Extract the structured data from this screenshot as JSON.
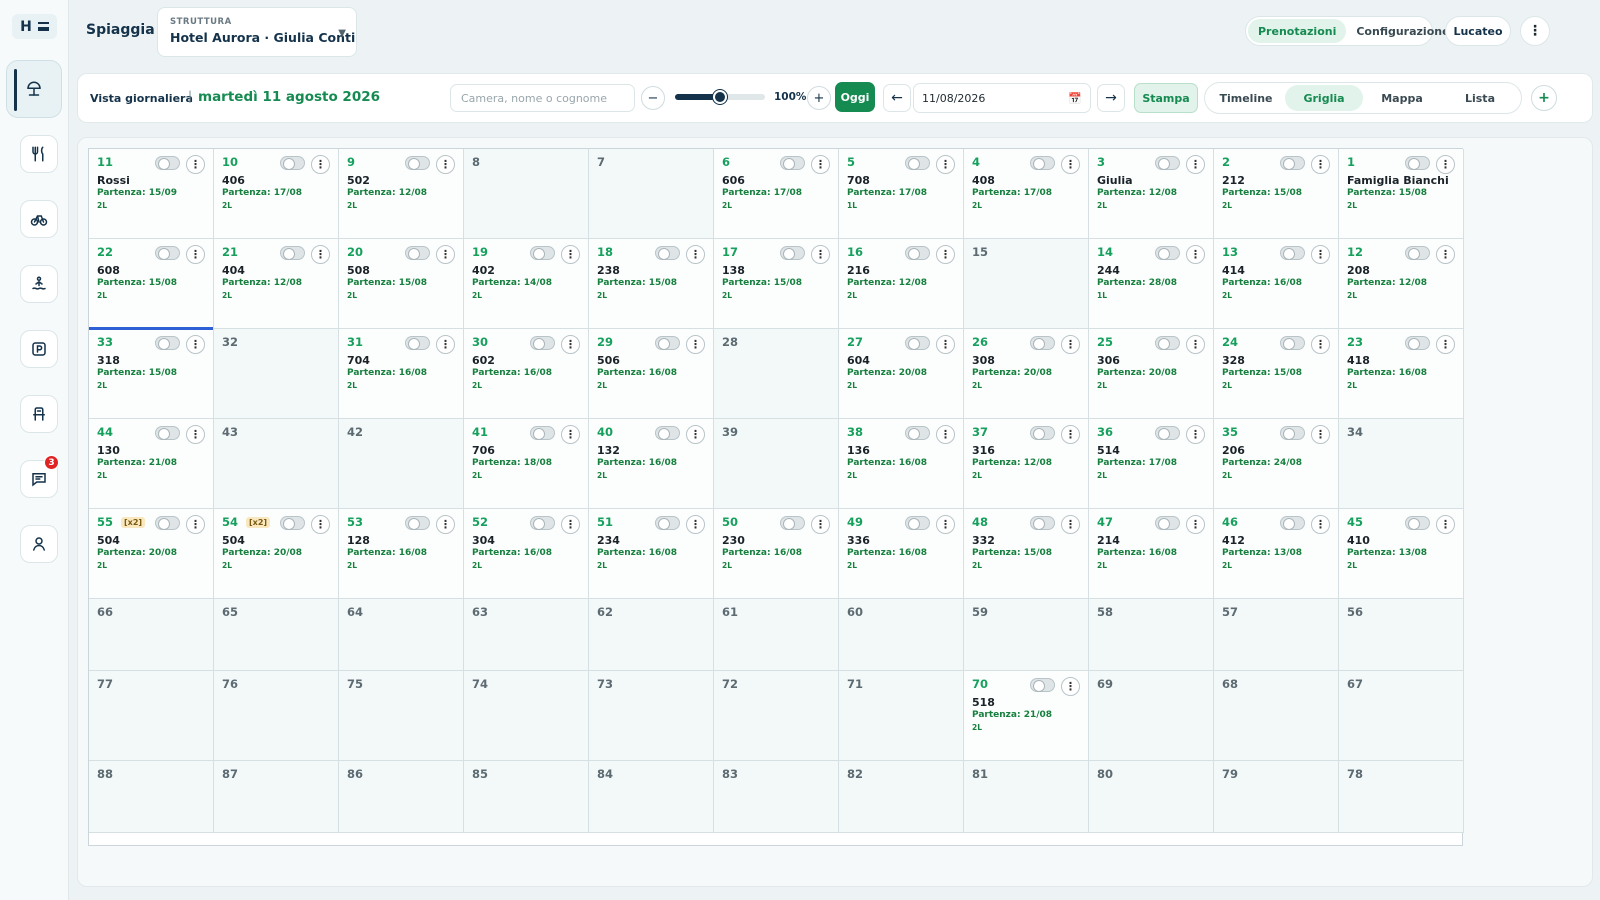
{
  "sidebar": {
    "logo_letter": "H",
    "items": [
      {
        "name": "beach-umbrella-icon",
        "active": true
      },
      {
        "name": "restaurant-icon",
        "active": false
      },
      {
        "name": "bicycle-icon",
        "active": false
      },
      {
        "name": "spa-icon",
        "active": false
      },
      {
        "name": "parking-icon",
        "active": false
      },
      {
        "name": "lounge-chair-icon",
        "active": false
      },
      {
        "name": "chat-icon",
        "active": false,
        "badge": "3"
      },
      {
        "name": "user-icon",
        "active": false
      }
    ]
  },
  "header": {
    "title": "Spiaggia",
    "struttura_label": "STRUTTURA",
    "struttura_value": "Hotel Aurora · Giulia Conti",
    "tabs": [
      "Prenotazioni",
      "Configurazione"
    ],
    "active_tab": "Prenotazioni",
    "user_button": "Lucateo"
  },
  "toolbar": {
    "view_label": "Vista giornaliera",
    "separator": "|",
    "date_text": "martedì 11 agosto 2026",
    "search_placeholder": "Camera, nome o cognome",
    "zoom_minus": "−",
    "zoom_plus": "+",
    "zoom_value": 0.5,
    "zoom_label": "100%",
    "today_button": "Oggi",
    "prev_arrow": "←",
    "next_arrow": "→",
    "date_input": "11/08/2026",
    "print_button": "Stampa",
    "views": [
      "Timeline",
      "Griglia",
      "Mappa",
      "Lista"
    ],
    "active_view": "Griglia",
    "add_button": "+"
  },
  "colors": {
    "accent": "#158a51",
    "occupied_number": "#17a05d",
    "selected": "#2d5fd6",
    "badge": "#e02424"
  },
  "grid": {
    "rows": [
      [
        {
          "n": "11",
          "guest": "Rossi",
          "dep": "Partenza: 15/09",
          "beds": "2L"
        },
        {
          "n": "10",
          "guest": "406",
          "dep": "Partenza: 17/08",
          "beds": "2L"
        },
        {
          "n": "9",
          "guest": "502",
          "dep": "Partenza: 12/08",
          "beds": "2L"
        },
        {
          "n": "8"
        },
        {
          "n": "7"
        },
        {
          "n": "6",
          "guest": "606",
          "dep": "Partenza: 17/08",
          "beds": "2L"
        },
        {
          "n": "5",
          "guest": "708",
          "dep": "Partenza: 17/08",
          "beds": "1L"
        },
        {
          "n": "4",
          "guest": "408",
          "dep": "Partenza: 17/08",
          "beds": "2L"
        },
        {
          "n": "3",
          "guest": "Giulia",
          "dep": "Partenza: 12/08",
          "beds": "2L"
        },
        {
          "n": "2",
          "guest": "212",
          "dep": "Partenza: 15/08",
          "beds": "2L"
        },
        {
          "n": "1",
          "guest": "Famiglia Bianchi",
          "dep": "Partenza: 15/08",
          "beds": "2L"
        }
      ],
      [
        {
          "n": "22",
          "guest": "608",
          "dep": "Partenza: 15/08",
          "beds": "2L"
        },
        {
          "n": "21",
          "guest": "404",
          "dep": "Partenza: 12/08",
          "beds": "2L"
        },
        {
          "n": "20",
          "guest": "508",
          "dep": "Partenza: 15/08",
          "beds": "2L"
        },
        {
          "n": "19",
          "guest": "402",
          "dep": "Partenza: 14/08",
          "beds": "2L"
        },
        {
          "n": "18",
          "guest": "238",
          "dep": "Partenza: 15/08",
          "beds": "2L"
        },
        {
          "n": "17",
          "guest": "138",
          "dep": "Partenza: 15/08",
          "beds": "2L"
        },
        {
          "n": "16",
          "guest": "216",
          "dep": "Partenza: 12/08",
          "beds": "2L"
        },
        {
          "n": "15"
        },
        {
          "n": "14",
          "guest": "244",
          "dep": "Partenza: 28/08",
          "beds": "1L"
        },
        {
          "n": "13",
          "guest": "414",
          "dep": "Partenza: 16/08",
          "beds": "2L"
        },
        {
          "n": "12",
          "guest": "208",
          "dep": "Partenza: 12/08",
          "beds": "2L"
        }
      ],
      [
        {
          "n": "33",
          "guest": "318",
          "dep": "Partenza: 15/08",
          "beds": "2L",
          "selected": true
        },
        {
          "n": "32"
        },
        {
          "n": "31",
          "guest": "704",
          "dep": "Partenza: 16/08",
          "beds": "2L"
        },
        {
          "n": "30",
          "guest": "602",
          "dep": "Partenza: 16/08",
          "beds": "2L"
        },
        {
          "n": "29",
          "guest": "506",
          "dep": "Partenza: 16/08",
          "beds": "2L"
        },
        {
          "n": "28"
        },
        {
          "n": "27",
          "guest": "604",
          "dep": "Partenza: 20/08",
          "beds": "2L"
        },
        {
          "n": "26",
          "guest": "308",
          "dep": "Partenza: 20/08",
          "beds": "2L"
        },
        {
          "n": "25",
          "guest": "306",
          "dep": "Partenza: 20/08",
          "beds": "2L"
        },
        {
          "n": "24",
          "guest": "328",
          "dep": "Partenza: 15/08",
          "beds": "2L"
        },
        {
          "n": "23",
          "guest": "418",
          "dep": "Partenza: 16/08",
          "beds": "2L"
        }
      ],
      [
        {
          "n": "44",
          "guest": "130",
          "dep": "Partenza: 21/08",
          "beds": "2L"
        },
        {
          "n": "43"
        },
        {
          "n": "42"
        },
        {
          "n": "41",
          "guest": "706",
          "dep": "Partenza: 18/08",
          "beds": "2L"
        },
        {
          "n": "40",
          "guest": "132",
          "dep": "Partenza: 16/08",
          "beds": "2L"
        },
        {
          "n": "39"
        },
        {
          "n": "38",
          "guest": "136",
          "dep": "Partenza: 16/08",
          "beds": "2L"
        },
        {
          "n": "37",
          "guest": "316",
          "dep": "Partenza: 12/08",
          "beds": "2L"
        },
        {
          "n": "36",
          "guest": "514",
          "dep": "Partenza: 17/08",
          "beds": "2L"
        },
        {
          "n": "35",
          "guest": "206",
          "dep": "Partenza: 24/08",
          "beds": "2L"
        },
        {
          "n": "34"
        }
      ],
      [
        {
          "n": "55",
          "tag": "[x2]",
          "guest": "504",
          "dep": "Partenza: 20/08",
          "beds": "2L"
        },
        {
          "n": "54",
          "tag": "[x2]",
          "guest": "504",
          "dep": "Partenza: 20/08",
          "beds": "2L"
        },
        {
          "n": "53",
          "guest": "128",
          "dep": "Partenza: 16/08",
          "beds": "2L"
        },
        {
          "n": "52",
          "guest": "304",
          "dep": "Partenza: 16/08",
          "beds": "2L"
        },
        {
          "n": "51",
          "guest": "234",
          "dep": "Partenza: 16/08",
          "beds": "2L"
        },
        {
          "n": "50",
          "guest": "230",
          "dep": "Partenza: 16/08",
          "beds": "2L"
        },
        {
          "n": "49",
          "guest": "336",
          "dep": "Partenza: 16/08",
          "beds": "2L"
        },
        {
          "n": "48",
          "guest": "332",
          "dep": "Partenza: 15/08",
          "beds": "2L"
        },
        {
          "n": "47",
          "guest": "214",
          "dep": "Partenza: 16/08",
          "beds": "2L"
        },
        {
          "n": "46",
          "guest": "412",
          "dep": "Partenza: 13/08",
          "beds": "2L"
        },
        {
          "n": "45",
          "guest": "410",
          "dep": "Partenza: 13/08",
          "beds": "2L"
        }
      ],
      [
        {
          "n": "66"
        },
        {
          "n": "65"
        },
        {
          "n": "64"
        },
        {
          "n": "63"
        },
        {
          "n": "62"
        },
        {
          "n": "61"
        },
        {
          "n": "60"
        },
        {
          "n": "59"
        },
        {
          "n": "58"
        },
        {
          "n": "57"
        },
        {
          "n": "56"
        }
      ],
      [
        {
          "n": "77"
        },
        {
          "n": "76"
        },
        {
          "n": "75"
        },
        {
          "n": "74"
        },
        {
          "n": "73"
        },
        {
          "n": "72"
        },
        {
          "n": "71"
        },
        {
          "n": "70",
          "guest": "518",
          "dep": "Partenza: 21/08",
          "beds": "2L"
        },
        {
          "n": "69"
        },
        {
          "n": "68"
        },
        {
          "n": "67"
        }
      ],
      [
        {
          "n": "88"
        },
        {
          "n": "87"
        },
        {
          "n": "86"
        },
        {
          "n": "85"
        },
        {
          "n": "84"
        },
        {
          "n": "83"
        },
        {
          "n": "82"
        },
        {
          "n": "81"
        },
        {
          "n": "80"
        },
        {
          "n": "79"
        },
        {
          "n": "78"
        }
      ]
    ]
  }
}
